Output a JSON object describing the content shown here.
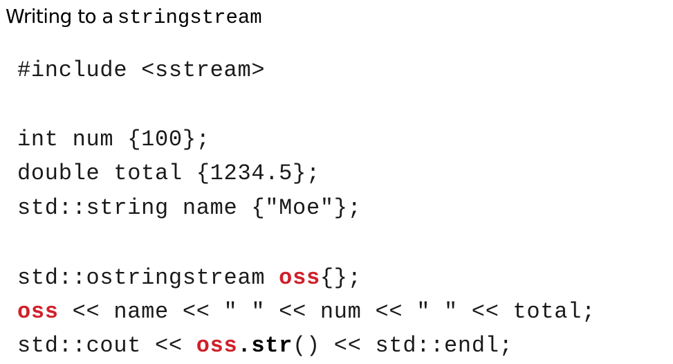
{
  "title": {
    "prefix": "Writing to a",
    "code": "stringstream"
  },
  "code": {
    "include": "#include <sstream>",
    "line_num": "int num {100};",
    "line_total": "double total {1234.5};",
    "line_name": "std::string name {\"Moe\"};",
    "oss_decl_pre": "std::ostringstream ",
    "oss": "oss",
    "oss_decl_post": "{};",
    "insert_post": " << name << \" \" << num << \" \" << total;",
    "cout_pre": "std::cout << ",
    "dot": ".",
    "str": "str",
    "cout_post": "() << std::endl;"
  },
  "colors": {
    "highlight": "#d0202a",
    "text": "#1a1a1a"
  }
}
